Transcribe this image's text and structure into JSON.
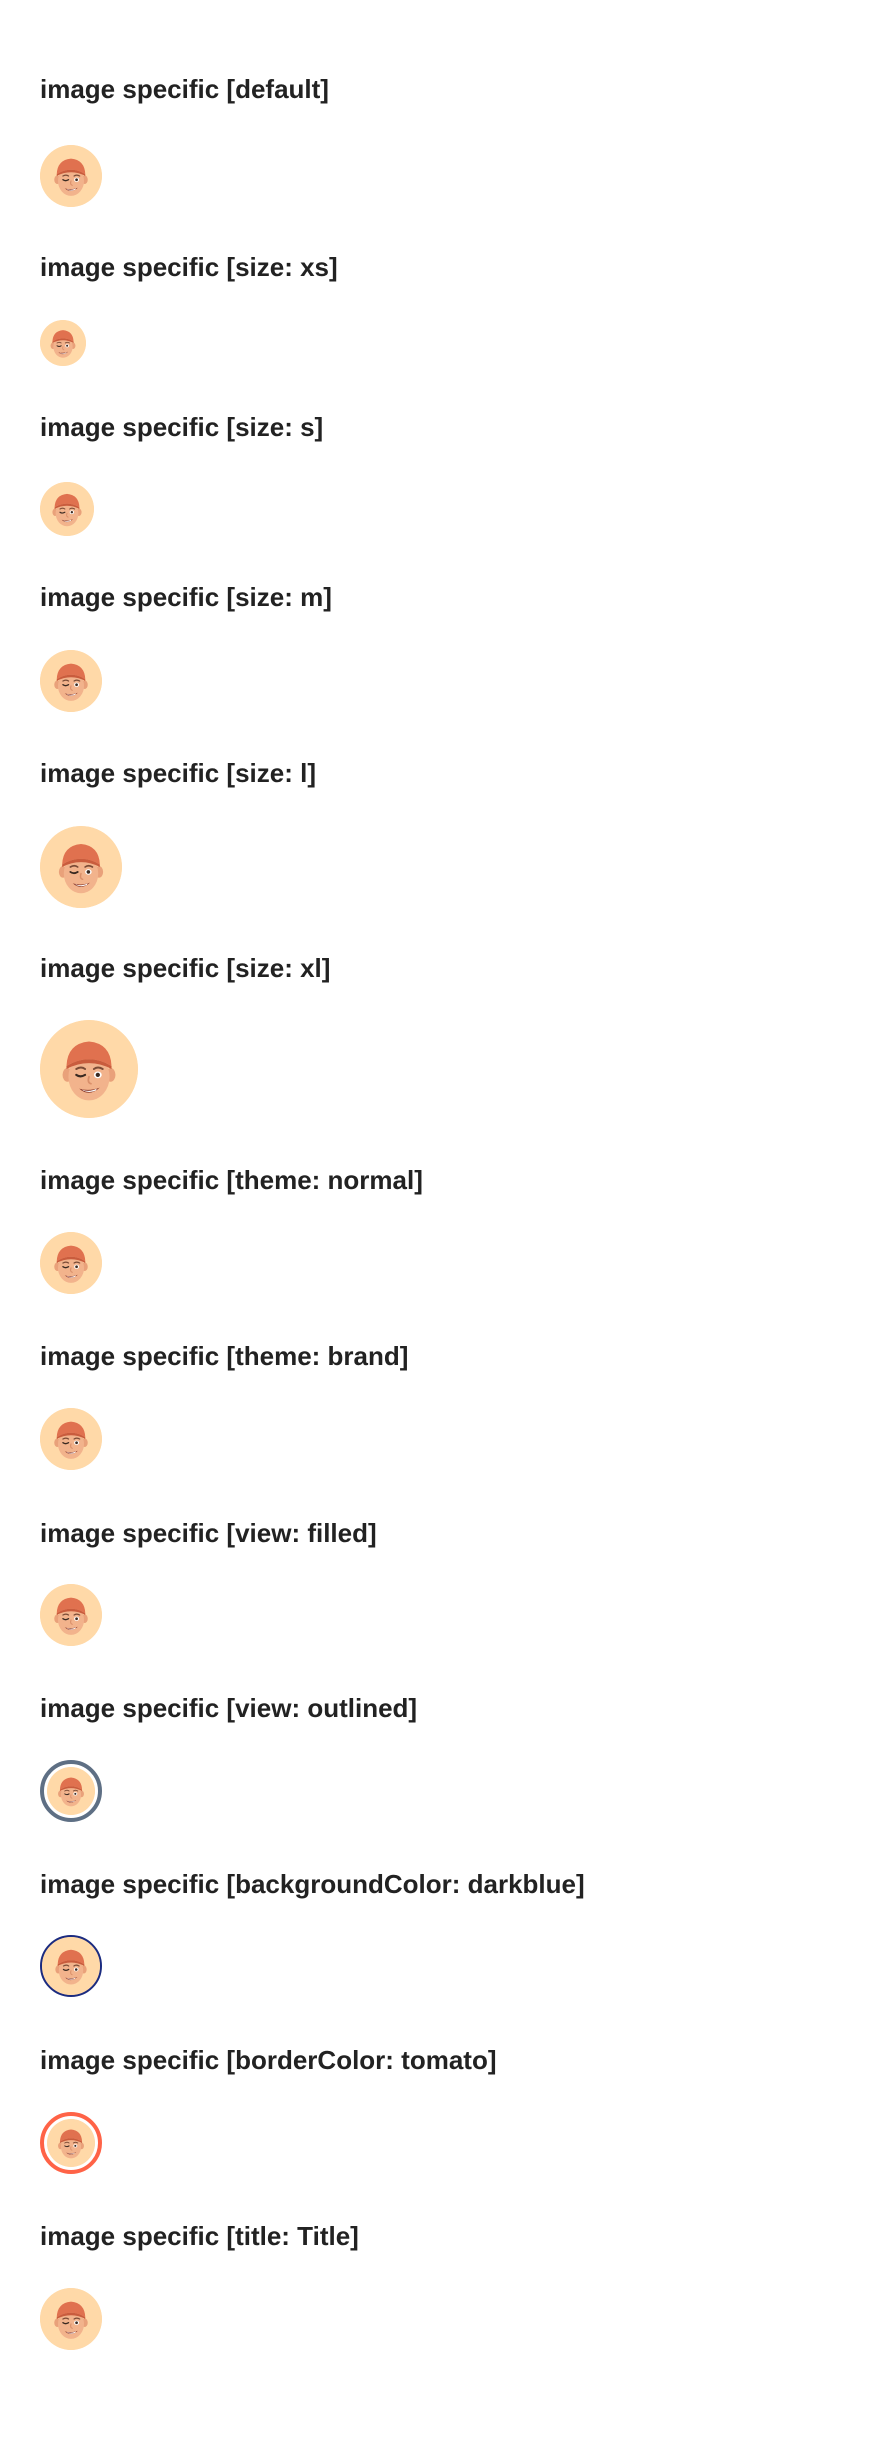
{
  "sections": [
    {
      "title": "image specific [default]"
    },
    {
      "title": "image specific [size: xs]"
    },
    {
      "title": "image specific [size: s]"
    },
    {
      "title": "image specific [size: m]"
    },
    {
      "title": "image specific [size: l]"
    },
    {
      "title": "image specific [size: xl]"
    },
    {
      "title": "image specific [theme: normal]"
    },
    {
      "title": "image specific [theme: brand]"
    },
    {
      "title": "image specific [view: filled]"
    },
    {
      "title": "image specific [view: outlined]"
    },
    {
      "title": "image specific [backgroundColor: darkblue]"
    },
    {
      "title": "image specific [borderColor: tomato]"
    },
    {
      "title": "image specific [title: Title]"
    }
  ],
  "colors": {
    "avatar_bg": "#ffd9a8",
    "outline": "#5e6f84",
    "darkblue": "#1b2b80",
    "tomato": "#ff6347"
  },
  "avatar_icon": "memoji-face-icon"
}
